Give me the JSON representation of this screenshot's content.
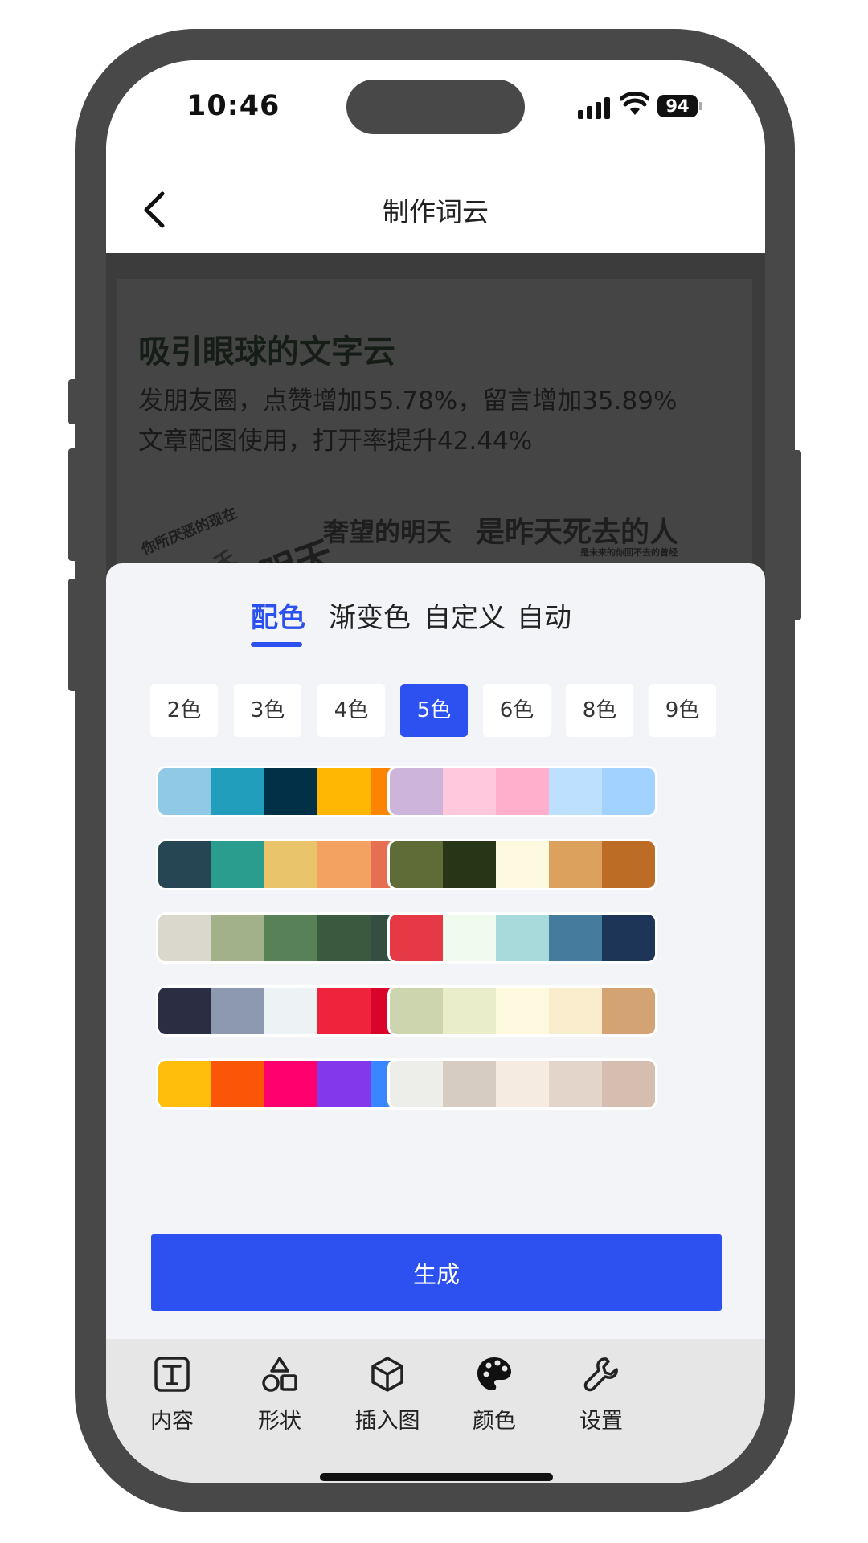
{
  "status_bar": {
    "time": "10:46",
    "battery": "94"
  },
  "nav": {
    "title": "制作词云"
  },
  "preview": {
    "headline": "吸引眼球的文字云",
    "line1": "发朋友圈，点赞增加55.78%，留言增加35.89%",
    "line2": "文章配图使用，打开率提升42.44%",
    "cloud_words": [
      "你所厌恶的现在",
      "奢望的明天",
      "是昨天死去的人",
      "是未来的你回不去的曾经",
      "明天",
      "今天"
    ]
  },
  "sheet": {
    "tabs": [
      "配色",
      "渐变色",
      "自定义",
      "自动"
    ],
    "active_tab": "配色",
    "color_counts": [
      "2色",
      "3色",
      "4色",
      "5色",
      "6色",
      "8色",
      "9色"
    ],
    "active_count": "5色",
    "palettes": [
      [
        "#8fc9e6",
        "#219ebc",
        "#023047",
        "#ffb703",
        "#fb8500"
      ],
      [
        "#cdb4db",
        "#ffc8dd",
        "#ffafcc",
        "#bde0fe",
        "#a2d2ff"
      ],
      [
        "#264653",
        "#2a9d8f",
        "#e9c46a",
        "#f4a261",
        "#e76f51"
      ],
      [
        "#606c38",
        "#283618",
        "#fefae0",
        "#dda15e",
        "#bc6c25"
      ],
      [
        "#dad7cd",
        "#a3b18a",
        "#588157",
        "#3a5a40",
        "#344e41"
      ],
      [
        "#e63946",
        "#f1faee",
        "#a8dadc",
        "#457b9d",
        "#1d3557"
      ],
      [
        "#2b2d42",
        "#8d99ae",
        "#edf2f4",
        "#ef233c",
        "#d90429"
      ],
      [
        "#ccd5ae",
        "#e9edc9",
        "#fefae0",
        "#faedcd",
        "#d4a373"
      ],
      [
        "#ffbe0b",
        "#fb5607",
        "#ff006e",
        "#8338ec",
        "#3a86ff"
      ],
      [
        "#edede9",
        "#d6ccc2",
        "#f5ebe0",
        "#e3d5ca",
        "#d5bdaf"
      ]
    ],
    "generate_label": "生成"
  },
  "toolbar": {
    "items": [
      {
        "label": "内容",
        "icon": "text-box-icon"
      },
      {
        "label": "形状",
        "icon": "shapes-icon"
      },
      {
        "label": "插入图",
        "icon": "cube-icon"
      },
      {
        "label": "颜色",
        "icon": "palette-icon"
      },
      {
        "label": "设置",
        "icon": "wrench-icon"
      }
    ]
  },
  "colors": {
    "accent": "#2d50f0",
    "sheet_bg": "#f3f4f8",
    "toolbar_bg": "#e6e6e6"
  }
}
